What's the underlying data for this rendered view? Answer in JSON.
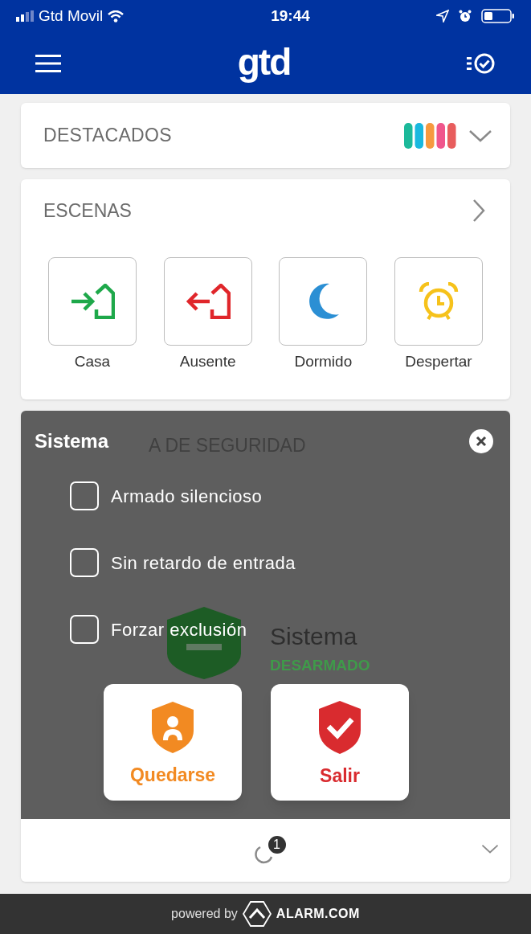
{
  "status_bar": {
    "carrier": "Gtd Movil",
    "time": "19:44"
  },
  "nav_bar": {
    "logo": "gtd"
  },
  "highlights": {
    "title": "DESTACADOS",
    "expanded": false
  },
  "scenes": {
    "title": "ESCENAS",
    "items": [
      {
        "label": "Casa",
        "kind": "home"
      },
      {
        "label": "Ausente",
        "kind": "away"
      },
      {
        "label": "Dormido",
        "kind": "sleep"
      },
      {
        "label": "Despertar",
        "kind": "wake"
      }
    ]
  },
  "security_card": {
    "title": "A DE SEGURIDAD",
    "system_label": "Sistema",
    "system_status": "DESARMADO",
    "notification_count": "1"
  },
  "dialog": {
    "title": "Sistema",
    "options": [
      {
        "label": "Armado silencioso",
        "checked": false
      },
      {
        "label": "Sin retardo de entrada",
        "checked": false
      },
      {
        "label": "Forzar exclusión",
        "checked": false
      }
    ],
    "actions": [
      {
        "label": "Quedarse",
        "kind": "stay"
      },
      {
        "label": "Salir",
        "kind": "away"
      }
    ]
  },
  "footer": {
    "prefix": "powered by",
    "brand": "ALARM.COM"
  }
}
